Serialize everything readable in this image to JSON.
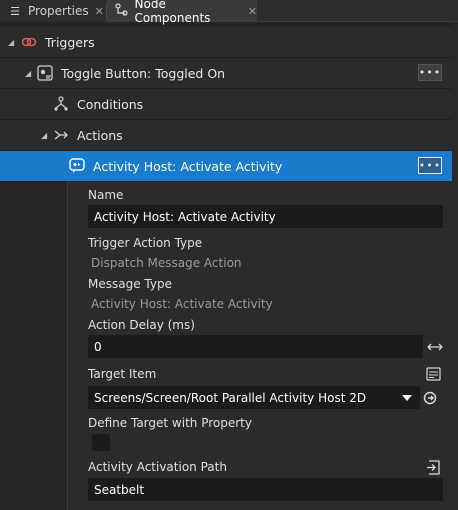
{
  "tabs": [
    {
      "label": "Properties",
      "icon": "list-icon"
    },
    {
      "label": "Node Components",
      "icon": "node-components-icon"
    }
  ],
  "tree": {
    "triggers_label": "Triggers",
    "toggle_label": "Toggle Button: Toggled On",
    "conditions_label": "Conditions",
    "actions_label": "Actions",
    "selected_label": "Activity Host: Activate Activity",
    "more_label": "•••"
  },
  "properties": {
    "name_label": "Name",
    "name_value": "Activity Host: Activate Activity",
    "trigger_action_type_label": "Trigger Action Type",
    "trigger_action_type_value": "Dispatch Message Action",
    "message_type_label": "Message Type",
    "message_type_value": "Activity Host: Activate Activity",
    "action_delay_label": "Action Delay (ms)",
    "action_delay_value": "0",
    "target_item_label": "Target Item",
    "target_item_value": "Screens/Screen/Root Parallel Activity Host 2D",
    "define_target_label": "Define Target with Property",
    "define_target_checked": false,
    "activation_path_label": "Activity Activation Path",
    "activation_path_value": "Seatbelt"
  },
  "colors": {
    "selected_row": "#1a7acb",
    "trigger_icon": "#e05a5a",
    "background": "#252526"
  }
}
